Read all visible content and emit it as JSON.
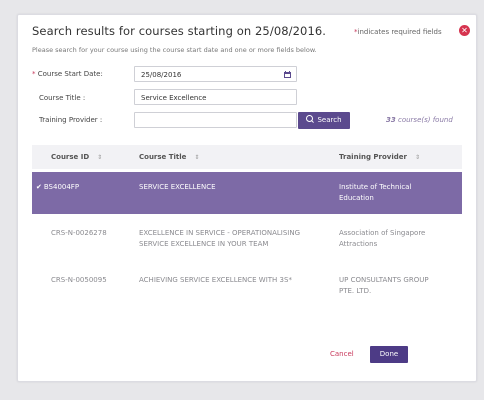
{
  "dialog": {
    "title": "Search results for courses starting on 25/08/2016.",
    "required_star": "*",
    "required_note": "indicates required fields",
    "hint": "Please search for your course using the course start date and one or more fields below."
  },
  "form": {
    "start_date_star": "*",
    "start_date_label": "Course Start Date:",
    "start_date_value": "25/08/2016",
    "course_title_label": "Course Title :",
    "course_title_value": "Service Excellence",
    "training_provider_label": "Training Provider :",
    "training_provider_value": "",
    "search_label": "Search",
    "found_count": "33",
    "found_suffix": "course(s) found"
  },
  "table": {
    "headers": {
      "course_id": "Course ID",
      "course_title": "Course Title",
      "training_provider": "Training Provider"
    },
    "rows": [
      {
        "id": "BS4004FP",
        "title": "SERVICE EXCELLENCE",
        "provider_line1": "Institute of Technical",
        "provider_line2": "Education",
        "selected": true
      },
      {
        "id": "CRS-N-0026278",
        "title_line1": "EXCELLENCE IN SERVICE - OPERATIONALISING",
        "title_line2": "SERVICE EXCELLENCE IN YOUR TEAM",
        "provider_line1": "Association of Singapore",
        "provider_line2": "Attractions",
        "selected": false
      },
      {
        "id": "CRS-N-0050095",
        "title": "ACHIEVING SERVICE EXCELLENCE WITH 3S*",
        "provider_line1": "UP CONSULTANTS GROUP",
        "provider_line2": "PTE. LTD.",
        "selected": false
      }
    ]
  },
  "actions": {
    "cancel_label": "Cancel",
    "done_label": "Done"
  },
  "colors": {
    "accent_purple": "#5b4a8e",
    "selected_row": "#7d6aa6",
    "done_button": "#4d3b86",
    "close_red": "#d6344f",
    "cancel_red": "#c8385b"
  },
  "icons": {
    "close": "x-circle",
    "calendar": "calendar",
    "search": "magnifier",
    "sort": "sort-arrows",
    "check": "checkmark"
  }
}
